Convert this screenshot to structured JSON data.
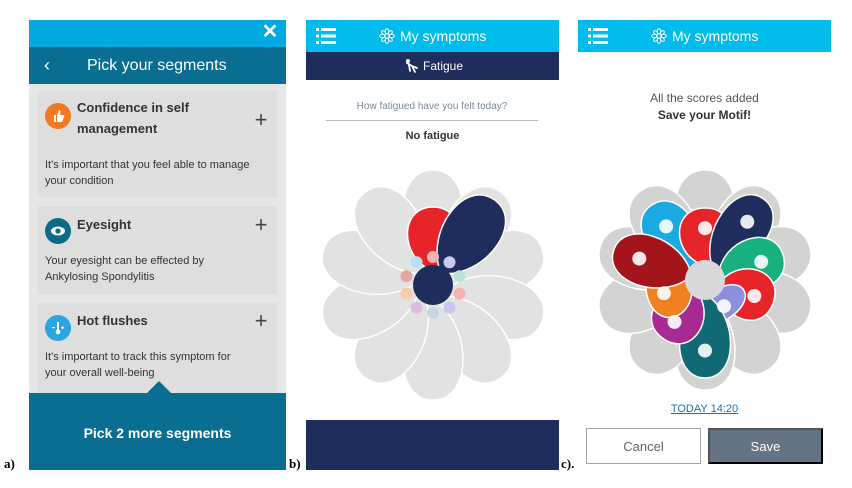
{
  "figure_labels": {
    "a": "a)",
    "b": "b)",
    "c": "c)."
  },
  "panel_a": {
    "close_glyph": "✕",
    "back_glyph": "‹",
    "title": "Pick your segments",
    "cards": [
      {
        "title": "Confidence in self management",
        "description": "It's important that you feel able to manage your condition",
        "icon": "thumbs-up-icon",
        "icon_color": "#f07a22"
      },
      {
        "title": "Eyesight",
        "description": "Your eyesight can be effected by Ankylosing Spondylitis",
        "icon": "eye-icon",
        "icon_color": "#0b6b84"
      },
      {
        "title": "Hot flushes",
        "description": "It's important to track this symptom for your overall well-being",
        "icon": "thermometer-icon",
        "icon_color": "#2aa6e2"
      }
    ],
    "plus_glyph": "+",
    "bottom_button": "Pick 2 more segments"
  },
  "panel_b": {
    "app_title": "My symptoms",
    "subheader": "Fatigue",
    "question": "How fatigued have you felt today?",
    "answer": "No fatigue",
    "colors": {
      "header": "#00bcec",
      "subheader": "#1f2d5c",
      "petal_gray": "#e2e2e2",
      "red": "#e8242b",
      "navy": "#1f2d5c"
    }
  },
  "panel_c": {
    "app_title": "My symptoms",
    "message_line1": "All the scores added",
    "message_line2": "Save your Motif!",
    "date": "TODAY 14:20",
    "cancel_label": "Cancel",
    "save_label": "Save",
    "petal_colors": {
      "thermometer": "#1aa9e0",
      "pain": "#e8242b",
      "fatigue": "#1f2d5c",
      "sleep": "#18b07f",
      "alert": "#e8242b",
      "exercise": "#8b8fdc",
      "heart": "#0f6a74",
      "foot": "#a72a92",
      "stiffness": "#f08020",
      "coffee": "#a3151a"
    }
  }
}
